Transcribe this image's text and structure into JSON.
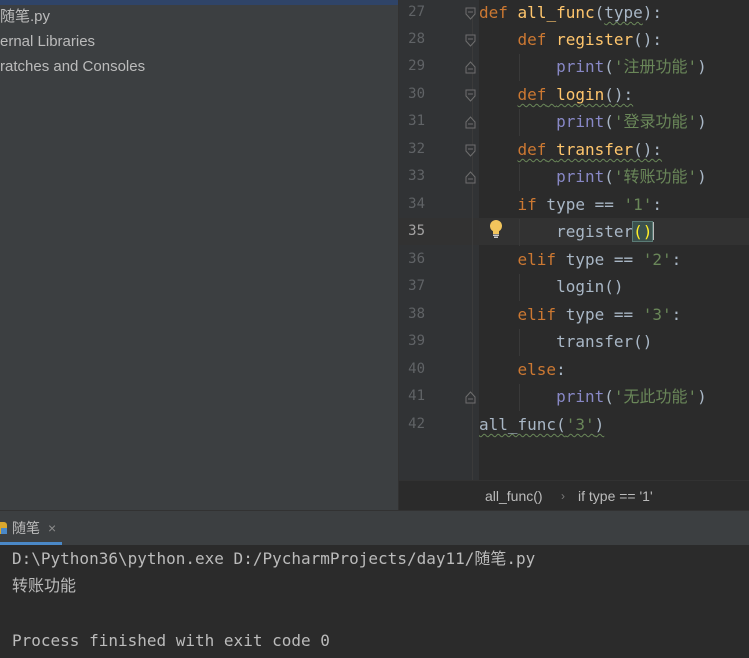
{
  "project_tree": {
    "items": [
      "随笔.py",
      "ernal Libraries",
      "ratches and Consoles"
    ]
  },
  "editor": {
    "line_numbers": [
      "27",
      "28",
      "29",
      "30",
      "31",
      "32",
      "33",
      "34",
      "35",
      "36",
      "37",
      "38",
      "39",
      "40",
      "41",
      "42"
    ],
    "current_line": "35",
    "code": {
      "l27": {
        "kw": "def",
        "fn": "all_func",
        "open": "(",
        "param": "type",
        "close": "):"
      },
      "l28": {
        "kw": "def",
        "fn": "register",
        "rest": "():"
      },
      "l29": {
        "bi": "print",
        "open": "(",
        "str": "'注册功能'",
        "close": ")"
      },
      "l30": {
        "kw": "def",
        "fn": "login",
        "rest": "():"
      },
      "l31": {
        "bi": "print",
        "open": "(",
        "str": "'登录功能'",
        "close": ")"
      },
      "l32": {
        "kw": "def",
        "fn": "transfer",
        "rest": "():"
      },
      "l33": {
        "bi": "print",
        "open": "(",
        "str": "'转账功能'",
        "close": ")"
      },
      "l34": {
        "kw": "if",
        "rest": " type == ",
        "str": "'1'",
        "colon": ":"
      },
      "l35": {
        "call": "register",
        "parens": "()"
      },
      "l36": {
        "kw": "elif",
        "rest": " type == ",
        "str": "'2'",
        "colon": ":"
      },
      "l37": {
        "call": "login()"
      },
      "l38": {
        "kw": "elif",
        "rest": " type == ",
        "str": "'3'",
        "colon": ":"
      },
      "l39": {
        "call": "transfer()"
      },
      "l40": {
        "kw": "else",
        "colon": ":"
      },
      "l41": {
        "bi": "print",
        "open": "(",
        "str": "'无此功能'",
        "close": ")"
      },
      "l42": {
        "call": "all_func",
        "open": "(",
        "str": "'3'",
        "close": ")"
      }
    }
  },
  "breadcrumb": {
    "items": [
      "all_func()",
      "if type == '1'"
    ],
    "separator": "›"
  },
  "run_panel": {
    "tab_label": "随笔",
    "tab_close": "×",
    "icon": "python-icon",
    "console_lines": [
      "D:\\Python36\\python.exe D:/PycharmProjects/day11/随笔.py",
      "转账功能",
      "",
      "Process finished with exit code 0"
    ]
  },
  "colors": {
    "keyword": "#cc7832",
    "function": "#ffc66d",
    "builtin": "#8888c6",
    "string": "#6a8759",
    "text": "#a9b7c6",
    "accent": "#4a88c7"
  }
}
